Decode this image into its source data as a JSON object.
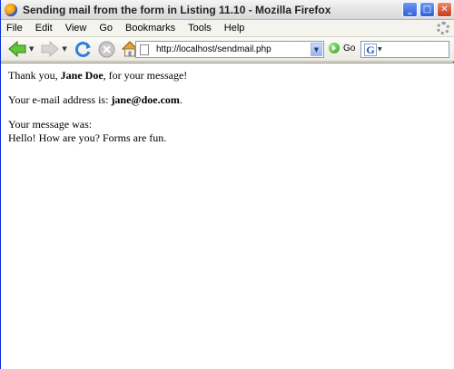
{
  "window": {
    "title": "Sending mail from the form in Listing 11.10 - Mozilla Firefox",
    "minimize_glyph": "_",
    "maximize_glyph": "□",
    "close_glyph": "✕"
  },
  "menubar": {
    "items": [
      {
        "label": "File"
      },
      {
        "label": "Edit"
      },
      {
        "label": "View"
      },
      {
        "label": "Go"
      },
      {
        "label": "Bookmarks"
      },
      {
        "label": "Tools"
      },
      {
        "label": "Help"
      }
    ]
  },
  "toolbar": {
    "url": "http://localhost/sendmail.php",
    "go_label": "Go",
    "search_engine_letter": "G",
    "icons": [
      "back-icon",
      "forward-icon",
      "reload-icon",
      "stop-icon",
      "home-icon",
      "go-icon",
      "google-icon"
    ]
  },
  "content": {
    "line1_prefix": "Thank you, ",
    "name": "Jane Doe",
    "line1_suffix": ", for your message!",
    "line2_prefix": "Your e-mail address is: ",
    "email": "jane@doe.com",
    "line2_suffix": ".",
    "line3": "Your message was:",
    "message": "Hello! How are you? Forms are fun."
  }
}
